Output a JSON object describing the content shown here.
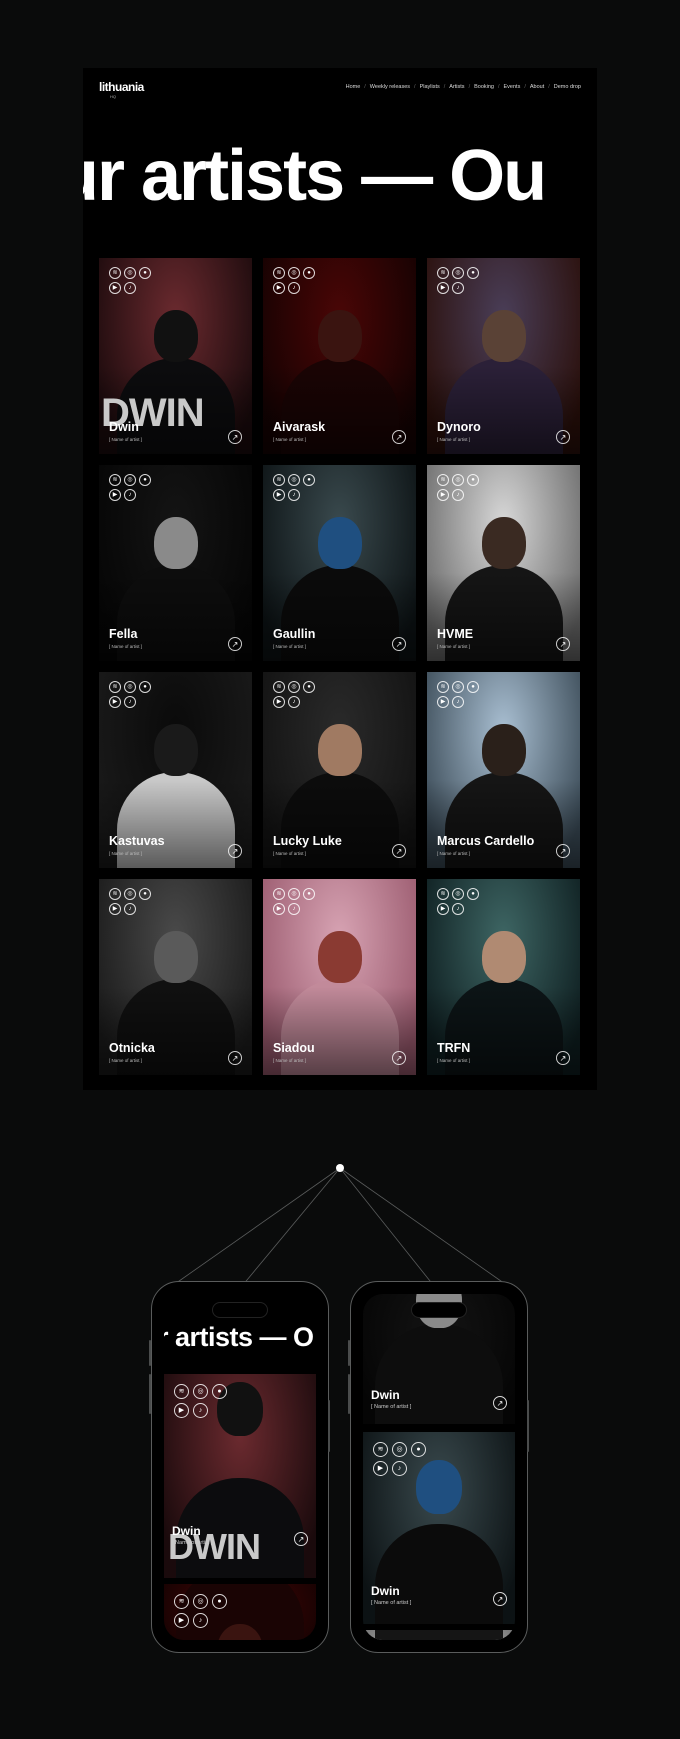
{
  "brand": {
    "logo": "lithuania",
    "logo_sub": "HQ"
  },
  "nav": [
    "Home",
    "Weekly releases",
    "Playlists",
    "Artists",
    "Booking",
    "Events",
    "About",
    "Demo drop"
  ],
  "hero": {
    "title": "ur artists — Ou",
    "mobile_title": "r artists — O"
  },
  "social_icons": [
    "spotify-icon",
    "instagram-icon",
    "apple-music-icon",
    "youtube-icon",
    "tiktok-icon"
  ],
  "social_glyphs": {
    "spotify-icon": "≋",
    "instagram-icon": "◎",
    "apple-music-icon": "●",
    "youtube-icon": "▶",
    "tiktok-icon": "♪"
  },
  "arrow_glyph": "↗",
  "artists": [
    {
      "name": "Dwin",
      "subtitle": "[ Name of artist ]",
      "bg": "#6b2a2f",
      "bg2": "#1a0a0c",
      "figure": "#0c0c0e",
      "head": "#111",
      "letters": "DWIN"
    },
    {
      "name": "Aivarask",
      "subtitle": "[ Name of artist ]",
      "bg": "#4a0606",
      "bg2": "#140202",
      "figure": "#1a0404",
      "head": "#3a1410"
    },
    {
      "name": "Dynoro",
      "subtitle": "[ Name of artist ]",
      "bg": "#4a3e58",
      "bg2": "#2a0f0a",
      "figure": "#2b2038",
      "head": "#5a4236"
    },
    {
      "name": "Fella",
      "subtitle": "[ Name of artist ]",
      "bg": "#141414",
      "bg2": "#050505",
      "figure": "#0d0d0d",
      "head": "#8a8a8a"
    },
    {
      "name": "Gaullin",
      "subtitle": "[ Name of artist ]",
      "bg": "#3a4a4e",
      "bg2": "#0c1214",
      "figure": "#0b0b0b",
      "head": "#1f4f80"
    },
    {
      "name": "HVME",
      "subtitle": "[ Name of artist ]",
      "bg": "#d8d8d8",
      "bg2": "#6a6a6a",
      "figure": "#151515",
      "head": "#3a2a22"
    },
    {
      "name": "Kastuvas",
      "subtitle": "[ Name of artist ]",
      "bg": "#0a0a0a",
      "bg2": "#1a1a1a",
      "figure": "#c9c9c9",
      "head": "#1a1a1a"
    },
    {
      "name": "Lucky Luke",
      "subtitle": "[ Name of artist ]",
      "bg": "#2a2a2a",
      "bg2": "#121212",
      "figure": "#0c0c0c",
      "head": "#a07a62"
    },
    {
      "name": "Marcus Cardello",
      "subtitle": "[ Name of artist ]",
      "bg": "#a9bfd2",
      "bg2": "#3a4a56",
      "figure": "#151515",
      "head": "#2a201a"
    },
    {
      "name": "Otnicka",
      "subtitle": "[ Name of artist ]",
      "bg": "#4a4a4a",
      "bg2": "#1a1a1a",
      "figure": "#101010",
      "head": "#5a5a5a"
    },
    {
      "name": "Siadou",
      "subtitle": "[ Name of artist ]",
      "bg": "#d7a3b3",
      "bg2": "#9a5a6e",
      "figure": "#c28a9a",
      "head": "#8a3a32"
    },
    {
      "name": "TRFN",
      "subtitle": "[ Name of artist ]",
      "bg": "#3e6664",
      "bg2": "#0e1e20",
      "figure": "#0c1416",
      "head": "#b08a72"
    }
  ],
  "mobile": {
    "phone1_cards": [
      {
        "name": "Dwin",
        "subtitle": "[ Name of artist ]"
      }
    ],
    "phone2_cards": [
      {
        "name": "Dwin",
        "subtitle": "[ Name of artist ]"
      },
      {
        "name": "Dwin",
        "subtitle": "[ Name of artist ]"
      }
    ]
  }
}
